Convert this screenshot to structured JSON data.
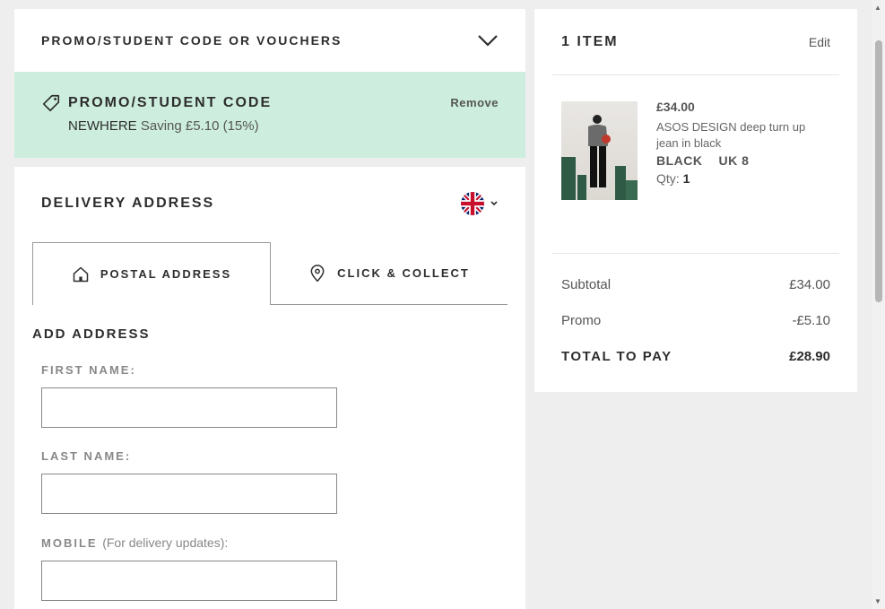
{
  "promo_section": {
    "header": "PROMO/STUDENT CODE OR VOUCHERS",
    "applied_title": "PROMO/STUDENT CODE",
    "remove_label": "Remove",
    "code": "NEWHERE",
    "saving_text": "Saving £5.10 (15%)"
  },
  "delivery": {
    "title": "DELIVERY ADDRESS",
    "country_icon": "uk-flag-icon",
    "tabs": [
      {
        "label": "POSTAL ADDRESS",
        "icon": "house-icon",
        "active": true
      },
      {
        "label": "CLICK & COLLECT",
        "icon": "location-pin-icon",
        "active": false
      }
    ],
    "form_title": "ADD ADDRESS",
    "fields": [
      {
        "label": "FIRST NAME:",
        "hint": "",
        "value": ""
      },
      {
        "label": "LAST NAME:",
        "hint": "",
        "value": ""
      },
      {
        "label": "MOBILE",
        "hint": "(For delivery updates):",
        "value": ""
      }
    ]
  },
  "summary": {
    "title": "1 ITEM",
    "edit_label": "Edit",
    "item": {
      "price": "£34.00",
      "name": "ASOS DESIGN deep turn up jean in black",
      "colour": "BLACK",
      "size": "UK 8",
      "qty_label": "Qty:",
      "qty": "1"
    },
    "lines": [
      {
        "label": "Subtotal",
        "value": "£34.00"
      },
      {
        "label": "Promo",
        "value": "-£5.10"
      },
      {
        "label": "TOTAL TO PAY",
        "value": "£28.90"
      }
    ]
  },
  "colors": {
    "promo_bg": "#cdeede",
    "page_bg": "#eeeeee",
    "text": "#2d2d2d"
  }
}
